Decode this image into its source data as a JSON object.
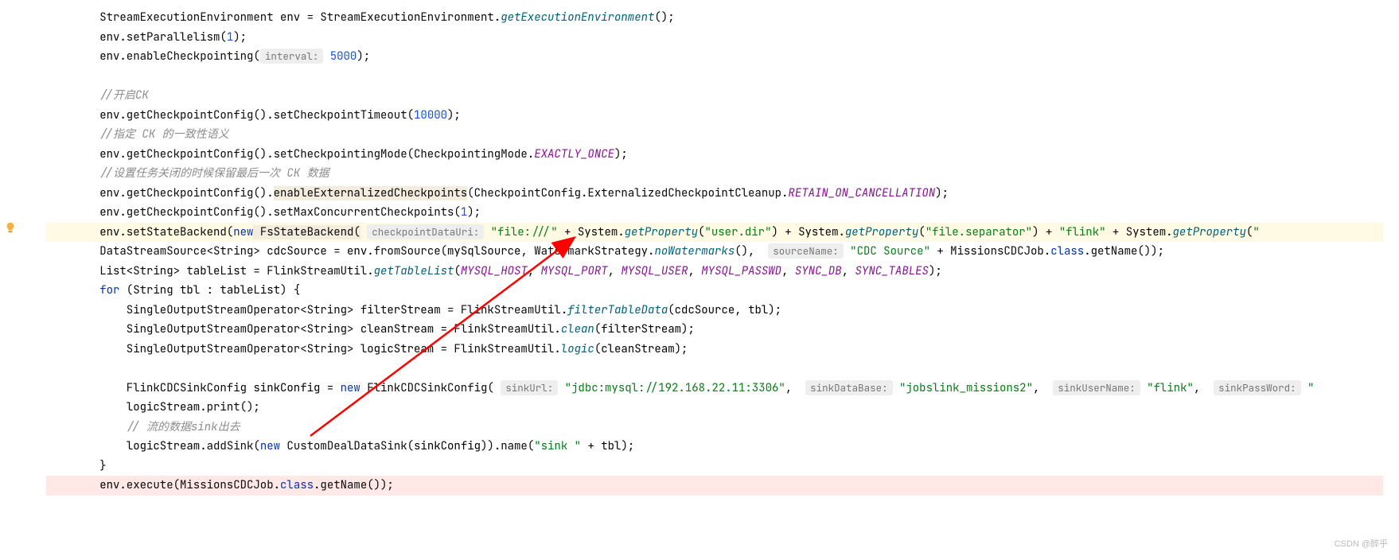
{
  "colors": {
    "keyword": "#0033B3",
    "string": "#067D17",
    "number": "#1750EB",
    "method": "#00627A",
    "field": "#871094",
    "comment": "#8C8C8C",
    "highlight": "#fffae3",
    "error_bg": "#ffe8e6"
  },
  "watermark": "CSDN @醉乎",
  "code": {
    "l1": {
      "a": "        StreamExecutionEnvironment ",
      "b": "env",
      "c": " = StreamExecutionEnvironment.",
      "d": "getExecutionEnvironment",
      "e": "();"
    },
    "l2": {
      "a": "        ",
      "b": "env",
      "c": ".setParallelism(",
      "d": "1",
      "e": ");"
    },
    "l3": {
      "a": "        ",
      "b": "env",
      "c": ".enableCheckpointing(",
      "hint": "interval:",
      "d": " 5000",
      "e": ");"
    },
    "l4": "",
    "l5": {
      "a": "        ",
      "c": "//开启CK"
    },
    "l6": {
      "a": "        ",
      "b": "env",
      "c": ".getCheckpointConfig().setCheckpointTimeout(",
      "d": "10000",
      "e": ");"
    },
    "l7": {
      "a": "        ",
      "c": "//指定 CK 的一致性语义"
    },
    "l8": {
      "a": "        ",
      "b": "env",
      "c": ".getCheckpointConfig().setCheckpointingMode(CheckpointingMode.",
      "d": "EXACTLY_ONCE",
      "e": ");"
    },
    "l9": {
      "a": "        ",
      "c": "//设置任务关闭的时候保留最后一次 CK 数据"
    },
    "l10": {
      "a": "        ",
      "b": "env",
      "c": ".getCheckpointConfig().",
      "dep": "enableExternalizedCheckpoints",
      "d": "(CheckpointConfig.ExternalizedCheckpointCleanup.",
      "f": "RETAIN_ON_CANCELLATION",
      "e": ");"
    },
    "l11": {
      "a": "        ",
      "b": "env",
      "c": ".getCheckpointConfig().setMaxConcurrentCheckpoints(",
      "d": "1",
      "e": ");"
    },
    "l12": {
      "a": "        ",
      "b": "env",
      "c": ".setStateBackend(",
      "kw": "new",
      "d": " FsStateBackend(",
      "hint": "checkpointDataUri:",
      "s1": " \"file:///\"",
      "p1": " + System.",
      "m1": "getProperty",
      "p2": "(",
      "s2": "\"user.dir\"",
      "p3": ") + System.",
      "m2": "getProperty",
      "p4": "(",
      "s3": "\"file.separator\"",
      "p5": ") + ",
      "s4": "\"flink\"",
      "p6": " + System.",
      "m3": "getProperty",
      "p7": "(",
      "s5": "\""
    },
    "l13": {
      "a": "        DataStreamSource<String> ",
      "b": "cdcSource",
      "c": " = ",
      "d": "env",
      "e": ".fromSource(",
      "f": "mySqlSource",
      "g": ", WatermarkStrategy.",
      "h": "noWatermarks",
      "i": "(), ",
      "hint": "sourceName:",
      "s1": " \"CDC Source\"",
      "j": " + MissionsCDCJob.",
      "k": "class",
      "lm": ".getName());"
    },
    "l14": {
      "a": "        List<String> ",
      "b": "tableList",
      "c": " = FlinkStreamUtil.",
      "d": "getTableList",
      "e": "(",
      "f1": "MYSQL_HOST",
      "g": ", ",
      "f2": "MYSQL_PORT",
      "f3": "MYSQL_USER",
      "f4": "MYSQL_PASSWD",
      "f5": "SYNC_DB",
      "f6": "SYNC_TABLES",
      "h": ");"
    },
    "l15": {
      "a": "        ",
      "kw": "for",
      "b": " (String ",
      "c": "tbl",
      "d": " : ",
      "e": "tableList",
      "f": ") {"
    },
    "l16": {
      "a": "            SingleOutputStreamOperator<String> ",
      "b": "filterStream",
      "c": " = FlinkStreamUtil.",
      "d": "filterTableData",
      "e": "(",
      "f": "cdcSource",
      "g": ", ",
      "h": "tbl",
      "i": ");"
    },
    "l17": {
      "a": "            SingleOutputStreamOperator<String> ",
      "b": "cleanStream",
      "c": " = FlinkStreamUtil.",
      "d": "clean",
      "e": "(",
      "f": "filterStream",
      "g": ");"
    },
    "l18": {
      "a": "            SingleOutputStreamOperator<String> ",
      "b": "logicStream",
      "c": " = FlinkStreamUtil.",
      "d": "logic",
      "e": "(",
      "f": "cleanStream",
      "g": ");"
    },
    "l19": "",
    "l20": {
      "a": "            FlinkCDCSinkConfig ",
      "b": "sinkConfig",
      "c": " = ",
      "kw": "new",
      "d": " FlinkCDCSinkConfig(",
      "h1": "sinkUrl:",
      "s1": " \"jdbc:mysql://192.168.22.11:3306\"",
      "g": ", ",
      "h2": "sinkDataBase:",
      "s2": " \"jobslink_missions2\"",
      "h3": "sinkUserName:",
      "s3": " \"flink\"",
      "h4": "sinkPassWord:",
      "s4": " \""
    },
    "l21": {
      "a": "            ",
      "b": "logicStream",
      "c": ".print();"
    },
    "l22": {
      "a": "            ",
      "c": "// 流的数据sink出去"
    },
    "l23": {
      "a": "            ",
      "b": "logicStream",
      "c": ".addSink(",
      "kw": "new",
      "d": " CustomDealDataSink(",
      "e": "sinkConfig",
      "f": ")).name(",
      "s1": "\"sink \"",
      "g": " + ",
      "h": "tbl",
      "i": ");"
    },
    "l24": {
      "a": "        }"
    },
    "l25": {
      "a": "        ",
      "b": "env",
      "c": ".execute(MissionsCDCJob.",
      "kw": "class",
      "d": ".getName());"
    }
  }
}
